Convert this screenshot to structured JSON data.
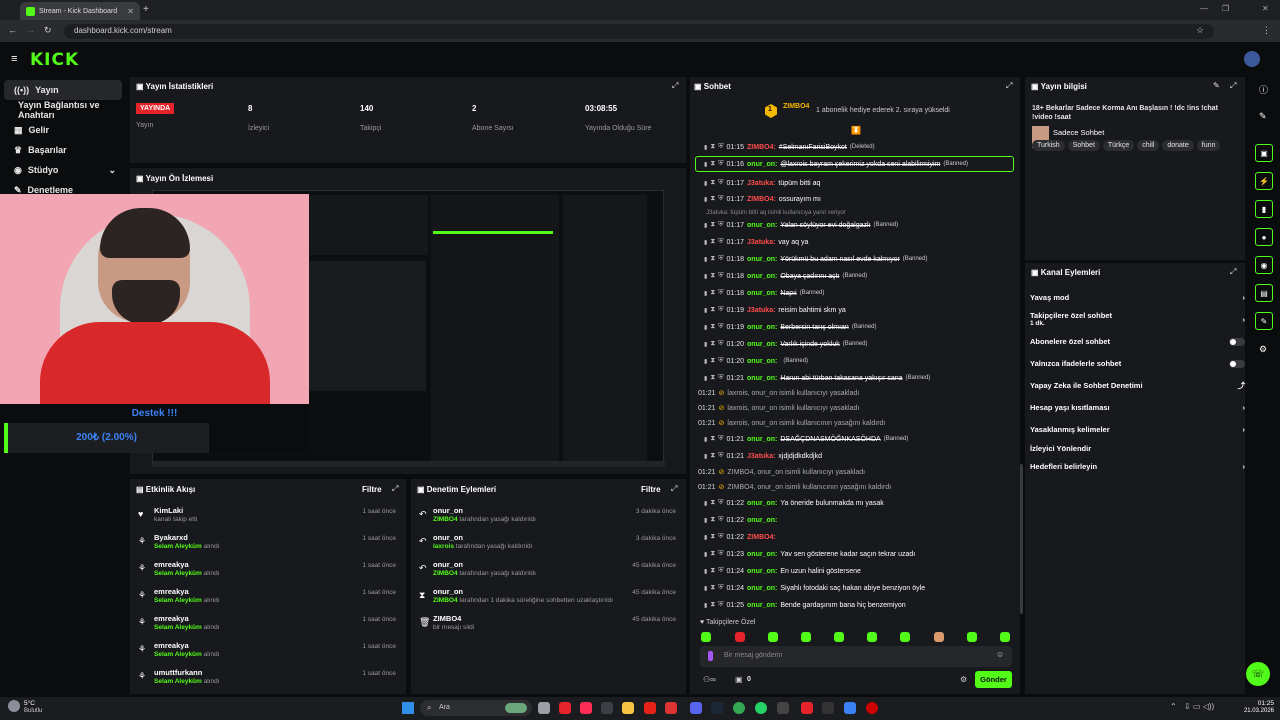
{
  "browser": {
    "tab_title": "Stream - Kick Dashboard",
    "new_tab": "+",
    "url": "dashboard.kick.com/stream"
  },
  "app": {
    "logo": "KICK"
  },
  "sidebar": {
    "items": [
      {
        "label": "Yayın",
        "icon": "broadcast-icon"
      },
      {
        "label": "Yayın Bağlantısı ve Anahtarı",
        "icon": ""
      },
      {
        "label": "Gelir",
        "icon": "revenue-icon"
      },
      {
        "label": "Başarılar",
        "icon": "trophy-icon"
      },
      {
        "label": "Stüdyo",
        "icon": "studio-icon"
      },
      {
        "label": "Denetleme",
        "icon": "wrench-icon"
      }
    ]
  },
  "stats": {
    "title": "Yayın İstatistikleri",
    "live_badge": "YAYINDA",
    "live_label": "Yayın",
    "viewers": "8",
    "viewers_label": "İzleyici",
    "followers": "140",
    "followers_label": "Takipçi",
    "subs": "2",
    "subs_label": "Abone Sayısı",
    "uptime": "03:08:55",
    "uptime_label": "Yayında Olduğu Süre"
  },
  "preview": {
    "title": "Yayın Ön İzlemesi"
  },
  "webcam": {
    "support": "Destek !!!",
    "goal": "200₺ (2.00%)",
    "goal_fraction": 0.02
  },
  "events": {
    "title": "Etkinlik Akışı",
    "filter": "Filtre",
    "items": [
      {
        "name": "KimLaki",
        "sub": "kanalı takip etti",
        "time": "1 saat önce"
      },
      {
        "name": "Byakarxd",
        "sub_green": "Selam Aleyküm",
        "sub": "alındı",
        "time": "1 saat önce"
      },
      {
        "name": "emreakya",
        "sub_green": "Selam Aleyküm",
        "sub": "alındı",
        "time": "1 saat önce"
      },
      {
        "name": "emreakya",
        "sub_green": "Selam Aleyküm",
        "sub": "alındı",
        "time": "1 saat önce"
      },
      {
        "name": "emreakya",
        "sub_green": "Selam Aleyküm",
        "sub": "alındı",
        "time": "1 saat önce"
      },
      {
        "name": "emreakya",
        "sub_green": "Selam Aleyküm",
        "sub": "alındı",
        "time": "1 saat önce"
      },
      {
        "name": "umuttfurkann",
        "sub_green": "Selam Aleyküm",
        "sub": "alındı",
        "time": "1 saat önce"
      }
    ]
  },
  "moderation": {
    "title": "Denetim Eylemleri",
    "filter": "Filtre",
    "items": [
      {
        "name": "onur_on",
        "actor": "ZIMBO4",
        "sub": "tarafından yasağı kaldırıldı",
        "time": "3 dakika önce"
      },
      {
        "name": "onur_on",
        "actor": "laxrois",
        "sub": "tarafından yasağı kaldırıldı",
        "time": "3 dakika önce"
      },
      {
        "name": "onur_on",
        "actor": "ZIMBO4",
        "sub": "tarafından yasağı kaldırıldı",
        "time": "45 dakika önce"
      },
      {
        "name": "onur_on",
        "actor": "ZIMBO4",
        "sub": "tarafından 1 dakika süreliğine sohbetten uzaklaştırıldı",
        "time": "45 dakika önce"
      },
      {
        "name": "ZIMBO4",
        "actor": "",
        "sub": "bir mesajı sildi",
        "time": "45 dakika önce"
      }
    ]
  },
  "chat": {
    "title": "Sohbet",
    "pinned_user": "ZIMBO4",
    "pinned_num": "1",
    "pinned_text": "1 abonelik hediye ederek 2. sıraya yükseldi",
    "reply_hint": "J3atuka: tüpüm bitti aq isimli kullanıcıya yanıt veriyor",
    "messages": [
      {
        "time": "01:15",
        "user": "ZIMBO4",
        "text": "#SelmanıFarisiBoykot",
        "note": "(Deleted)",
        "ucolor": "#ff4d4d"
      },
      {
        "time": "01:16",
        "user": "onur_on",
        "text": "@laxrois bayram şekerimiz yokda seni alabilirmiyim",
        "note": "(Banned)",
        "ucolor": "#53fc18"
      },
      {
        "time": "01:17",
        "user": "J3atuka",
        "text": "tüpüm bitti aq",
        "note": "",
        "ucolor": "#ff4d4d"
      },
      {
        "time": "01:17",
        "user": "ZIMBO4",
        "text": "ossurayım mı",
        "note": "",
        "ucolor": "#ff4d4d"
      },
      {
        "time": "01:17",
        "user": "onur_on",
        "text": "Yalan söylüyor evi doğalgazlı",
        "note": "(Banned)",
        "ucolor": "#53fc18"
      },
      {
        "time": "01:17",
        "user": "J3atuka",
        "text": "vay aq ya",
        "note": "",
        "ucolor": "#ff4d4d"
      },
      {
        "time": "01:18",
        "user": "onur_on",
        "text": "Yörükmü bu adam nasıl evde kalmıyor",
        "note": "(Banned)",
        "ucolor": "#53fc18"
      },
      {
        "time": "01:18",
        "user": "onur_on",
        "text": "Obaya çadırını açtı",
        "note": "(Banned)",
        "ucolor": "#53fc18"
      },
      {
        "time": "01:18",
        "user": "onur_on",
        "text": "Napıi",
        "note": "(Banned)",
        "ucolor": "#53fc18"
      },
      {
        "time": "01:19",
        "user": "J3atuka",
        "text": "reisim bahtimi skm ya",
        "note": "",
        "ucolor": "#ff4d4d"
      },
      {
        "time": "01:19",
        "user": "onur_on",
        "text": "Berbersin tarış olmıan",
        "note": "(Banned)",
        "ucolor": "#53fc18"
      },
      {
        "time": "01:20",
        "user": "onur_on",
        "text": "Varlık içinde yokluk",
        "note": "(Banned)",
        "ucolor": "#53fc18"
      },
      {
        "time": "01:20",
        "user": "onur_on",
        "text": "",
        "note": "(Banned)",
        "ucolor": "#53fc18"
      },
      {
        "time": "01:21",
        "user": "onur_on",
        "text": "Harun abi türban takasana yakışır sana",
        "note": "(Banned)",
        "ucolor": "#53fc18"
      }
    ],
    "system": [
      {
        "time": "01:21",
        "text": "laxrois, onur_on isimli kullanıcıyı yasakladı"
      },
      {
        "time": "01:21",
        "text": "laxrois, onur_on isimli kullanıcıyı yasakladı"
      },
      {
        "time": "01:21",
        "text": "laxrois, onur_on isimli kullanıcının yasağını kaldırdı"
      }
    ],
    "messages2": [
      {
        "time": "01:21",
        "user": "onur_on",
        "text": "DSAĞÇDNASMÖĞNKASÖHDA",
        "note": "(Banned)",
        "ucolor": "#53fc18"
      },
      {
        "time": "01:21",
        "user": "J3atuka",
        "text": "xjdjdjdkdkdjkd",
        "note": "",
        "ucolor": "#ff4d4d"
      }
    ],
    "system2": [
      {
        "time": "01:21",
        "text": "ZIMBO4, onur_on isimli kullanıcıyı yasakladı"
      },
      {
        "time": "01:21",
        "text": "ZIMBO4, onur_on isimli kullanıcının yasağını kaldırdı"
      }
    ],
    "messages3": [
      {
        "time": "01:22",
        "user": "onur_on",
        "text": "Ya öneride bulunmakda mı yasak",
        "ucolor": "#53fc18"
      },
      {
        "time": "01:22",
        "user": "onur_on",
        "text": "",
        "ucolor": "#53fc18"
      },
      {
        "time": "01:22",
        "user": "ZIMBO4",
        "text": "",
        "ucolor": "#ff4d4d"
      },
      {
        "time": "01:23",
        "user": "onur_on",
        "text": "Yav sen gösterene kadar saçın tekrar uzadı",
        "ucolor": "#53fc18"
      },
      {
        "time": "01:24",
        "user": "onur_on",
        "text": "En uzun halini göstersene",
        "ucolor": "#53fc18"
      },
      {
        "time": "01:24",
        "user": "onur_on",
        "text": "Siyahlı fotodaki saç hakan abiye benziyon öyle",
        "ucolor": "#53fc18"
      },
      {
        "time": "01:25",
        "user": "onur_on",
        "text": "Bende gardaşınım bana hiç benzemiyon",
        "ucolor": "#53fc18"
      }
    ],
    "followers_only": "Takipçilere Özel",
    "input_placeholder": "Bir mesaj gönderin",
    "count": "0",
    "send": "Gönder"
  },
  "stream_info": {
    "title": "Yayın bilgisi",
    "stream_title": "18+ Bekarlar Sadece Korma Anı Başlasın ! !dc !ins !chat !video !saat",
    "category": "Sadece Sohbet",
    "tags": [
      "Turkish",
      "Sohbet",
      "Türkçe",
      "chill",
      "donate",
      "funn"
    ]
  },
  "channel_actions": {
    "title": "Kanal Eylemleri",
    "items": [
      {
        "label": "Yavaş mod",
        "kind": "arrow"
      },
      {
        "label": "Takipçilere özel sohbet",
        "sub": "1 dk.",
        "kind": "arrow"
      },
      {
        "label": "Abonelere özel sohbet",
        "kind": "toggle"
      },
      {
        "label": "Yalnızca ifadelerle sohbet",
        "kind": "toggle"
      },
      {
        "label": "Yapay Zeka ile Sohbet Denetimi",
        "kind": "external"
      },
      {
        "label": "Hesap yaşı kısıtlaması",
        "kind": "arrow"
      },
      {
        "label": "Yasaklanmış kelimeler",
        "kind": "arrow"
      },
      {
        "label": "İzleyici Yönlendir",
        "kind": "none"
      },
      {
        "label": "Hedefleri belirleyin",
        "kind": "arrow"
      }
    ]
  },
  "taskbar": {
    "weather_temp": "5°C",
    "weather_text": "Bulutlu",
    "search": "Ara",
    "time": "01:25",
    "date": "21.03.2026"
  },
  "colors": {
    "accent": "#53fc18",
    "live": "#e5232b",
    "panel": "#18191c"
  }
}
